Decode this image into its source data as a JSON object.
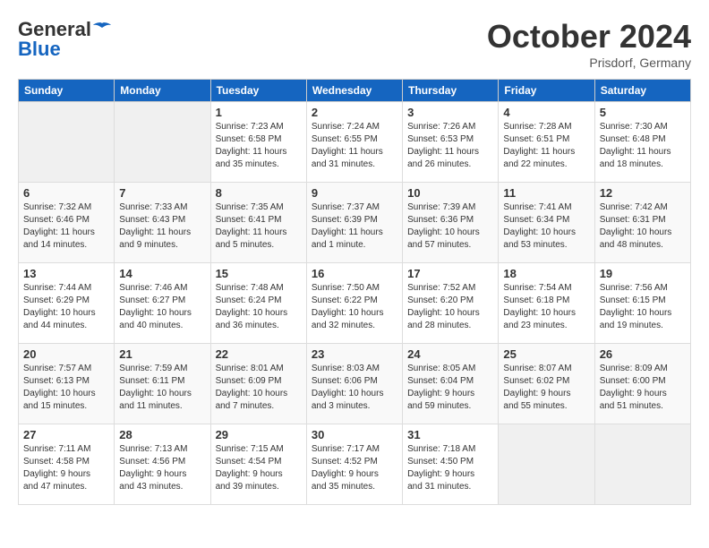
{
  "header": {
    "logo_line1": "General",
    "logo_line2": "Blue",
    "month": "October 2024",
    "location": "Prisdorf, Germany"
  },
  "days_of_week": [
    "Sunday",
    "Monday",
    "Tuesday",
    "Wednesday",
    "Thursday",
    "Friday",
    "Saturday"
  ],
  "weeks": [
    [
      {
        "day": "",
        "content": ""
      },
      {
        "day": "",
        "content": ""
      },
      {
        "day": "1",
        "content": "Sunrise: 7:23 AM\nSunset: 6:58 PM\nDaylight: 11 hours\nand 35 minutes."
      },
      {
        "day": "2",
        "content": "Sunrise: 7:24 AM\nSunset: 6:55 PM\nDaylight: 11 hours\nand 31 minutes."
      },
      {
        "day": "3",
        "content": "Sunrise: 7:26 AM\nSunset: 6:53 PM\nDaylight: 11 hours\nand 26 minutes."
      },
      {
        "day": "4",
        "content": "Sunrise: 7:28 AM\nSunset: 6:51 PM\nDaylight: 11 hours\nand 22 minutes."
      },
      {
        "day": "5",
        "content": "Sunrise: 7:30 AM\nSunset: 6:48 PM\nDaylight: 11 hours\nand 18 minutes."
      }
    ],
    [
      {
        "day": "6",
        "content": "Sunrise: 7:32 AM\nSunset: 6:46 PM\nDaylight: 11 hours\nand 14 minutes."
      },
      {
        "day": "7",
        "content": "Sunrise: 7:33 AM\nSunset: 6:43 PM\nDaylight: 11 hours\nand 9 minutes."
      },
      {
        "day": "8",
        "content": "Sunrise: 7:35 AM\nSunset: 6:41 PM\nDaylight: 11 hours\nand 5 minutes."
      },
      {
        "day": "9",
        "content": "Sunrise: 7:37 AM\nSunset: 6:39 PM\nDaylight: 11 hours\nand 1 minute."
      },
      {
        "day": "10",
        "content": "Sunrise: 7:39 AM\nSunset: 6:36 PM\nDaylight: 10 hours\nand 57 minutes."
      },
      {
        "day": "11",
        "content": "Sunrise: 7:41 AM\nSunset: 6:34 PM\nDaylight: 10 hours\nand 53 minutes."
      },
      {
        "day": "12",
        "content": "Sunrise: 7:42 AM\nSunset: 6:31 PM\nDaylight: 10 hours\nand 48 minutes."
      }
    ],
    [
      {
        "day": "13",
        "content": "Sunrise: 7:44 AM\nSunset: 6:29 PM\nDaylight: 10 hours\nand 44 minutes."
      },
      {
        "day": "14",
        "content": "Sunrise: 7:46 AM\nSunset: 6:27 PM\nDaylight: 10 hours\nand 40 minutes."
      },
      {
        "day": "15",
        "content": "Sunrise: 7:48 AM\nSunset: 6:24 PM\nDaylight: 10 hours\nand 36 minutes."
      },
      {
        "day": "16",
        "content": "Sunrise: 7:50 AM\nSunset: 6:22 PM\nDaylight: 10 hours\nand 32 minutes."
      },
      {
        "day": "17",
        "content": "Sunrise: 7:52 AM\nSunset: 6:20 PM\nDaylight: 10 hours\nand 28 minutes."
      },
      {
        "day": "18",
        "content": "Sunrise: 7:54 AM\nSunset: 6:18 PM\nDaylight: 10 hours\nand 23 minutes."
      },
      {
        "day": "19",
        "content": "Sunrise: 7:56 AM\nSunset: 6:15 PM\nDaylight: 10 hours\nand 19 minutes."
      }
    ],
    [
      {
        "day": "20",
        "content": "Sunrise: 7:57 AM\nSunset: 6:13 PM\nDaylight: 10 hours\nand 15 minutes."
      },
      {
        "day": "21",
        "content": "Sunrise: 7:59 AM\nSunset: 6:11 PM\nDaylight: 10 hours\nand 11 minutes."
      },
      {
        "day": "22",
        "content": "Sunrise: 8:01 AM\nSunset: 6:09 PM\nDaylight: 10 hours\nand 7 minutes."
      },
      {
        "day": "23",
        "content": "Sunrise: 8:03 AM\nSunset: 6:06 PM\nDaylight: 10 hours\nand 3 minutes."
      },
      {
        "day": "24",
        "content": "Sunrise: 8:05 AM\nSunset: 6:04 PM\nDaylight: 9 hours\nand 59 minutes."
      },
      {
        "day": "25",
        "content": "Sunrise: 8:07 AM\nSunset: 6:02 PM\nDaylight: 9 hours\nand 55 minutes."
      },
      {
        "day": "26",
        "content": "Sunrise: 8:09 AM\nSunset: 6:00 PM\nDaylight: 9 hours\nand 51 minutes."
      }
    ],
    [
      {
        "day": "27",
        "content": "Sunrise: 7:11 AM\nSunset: 4:58 PM\nDaylight: 9 hours\nand 47 minutes."
      },
      {
        "day": "28",
        "content": "Sunrise: 7:13 AM\nSunset: 4:56 PM\nDaylight: 9 hours\nand 43 minutes."
      },
      {
        "day": "29",
        "content": "Sunrise: 7:15 AM\nSunset: 4:54 PM\nDaylight: 9 hours\nand 39 minutes."
      },
      {
        "day": "30",
        "content": "Sunrise: 7:17 AM\nSunset: 4:52 PM\nDaylight: 9 hours\nand 35 minutes."
      },
      {
        "day": "31",
        "content": "Sunrise: 7:18 AM\nSunset: 4:50 PM\nDaylight: 9 hours\nand 31 minutes."
      },
      {
        "day": "",
        "content": ""
      },
      {
        "day": "",
        "content": ""
      }
    ]
  ]
}
